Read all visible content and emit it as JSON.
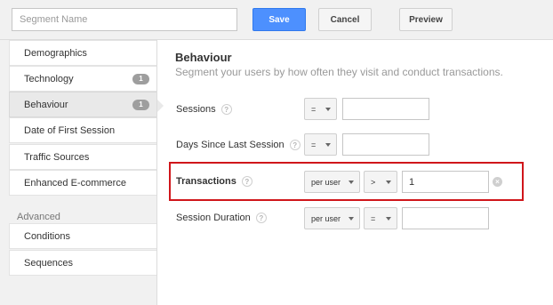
{
  "toolbar": {
    "segment_name_placeholder": "Segment Name",
    "save_label": "Save",
    "cancel_label": "Cancel",
    "preview_label": "Preview"
  },
  "sidebar": {
    "items": [
      {
        "label": "Demographics",
        "badge": ""
      },
      {
        "label": "Technology",
        "badge": "1"
      },
      {
        "label": "Behaviour",
        "badge": "1",
        "active": true
      },
      {
        "label": "Date of First Session",
        "badge": ""
      },
      {
        "label": "Traffic Sources",
        "badge": ""
      },
      {
        "label": "Enhanced E-commerce",
        "badge": ""
      }
    ],
    "advanced_label": "Advanced",
    "advanced_items": [
      {
        "label": "Conditions"
      },
      {
        "label": "Sequences"
      }
    ]
  },
  "main": {
    "title": "Behaviour",
    "subtitle": "Segment your users by how often they visit and conduct transactions.",
    "rows": [
      {
        "label": "Sessions",
        "scope": "",
        "operator": "=",
        "value": ""
      },
      {
        "label": "Days Since Last Session",
        "scope": "",
        "operator": "=",
        "value": ""
      },
      {
        "label": "Transactions",
        "scope": "per user",
        "operator": ">",
        "value": "1"
      },
      {
        "label": "Session Duration",
        "scope": "per user",
        "operator": "=",
        "value": ""
      }
    ],
    "help_glyph": "?",
    "clear_glyph": "×"
  },
  "colors": {
    "primary_button": "#4d90fe",
    "highlight_border": "#d0161b",
    "badge": "#9e9e9e"
  }
}
